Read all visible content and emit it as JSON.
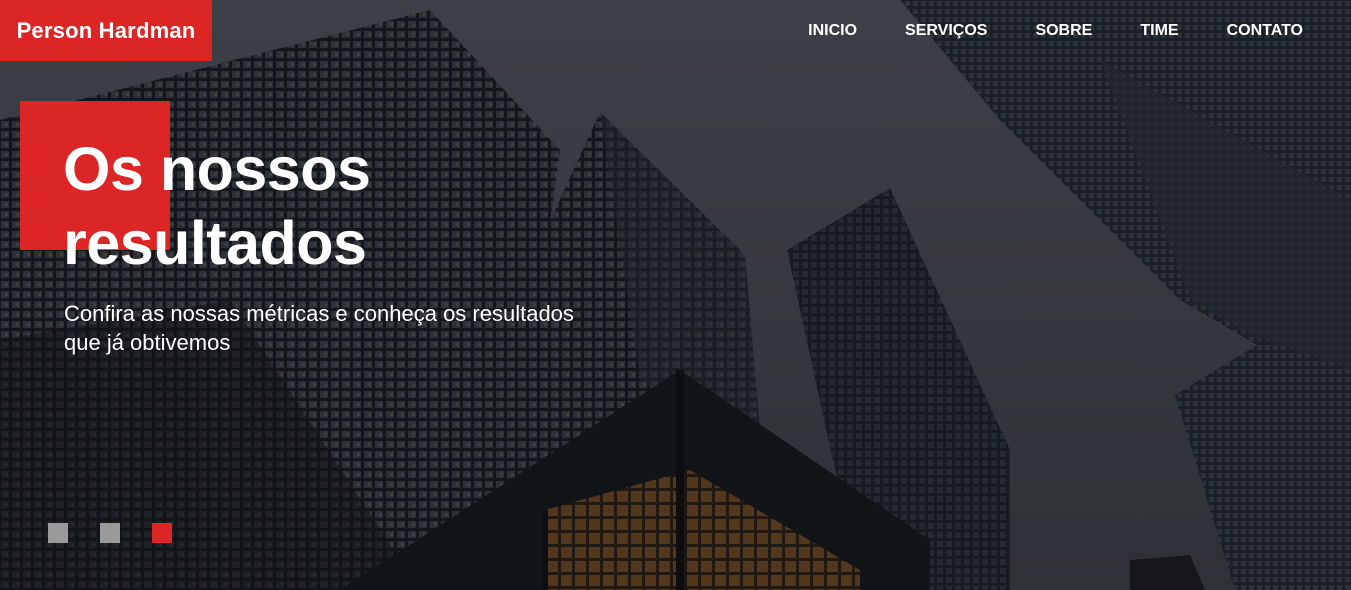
{
  "brand": {
    "name": "Person Hardman",
    "color": "#dc2626"
  },
  "nav": {
    "items": [
      "INICIO",
      "SERVIÇOS",
      "SOBRE",
      "TIME",
      "CONTATO"
    ]
  },
  "hero": {
    "headline": "Os nossos\nresultados",
    "subtitle": "Confira as nossas métricas e conheça os resultados que já obtivemos",
    "background": "city-skyscrapers-photo"
  },
  "slider": {
    "count": 3,
    "active_index": 2,
    "inactive_color": "#9a9a9a",
    "active_color": "#dc2626"
  }
}
